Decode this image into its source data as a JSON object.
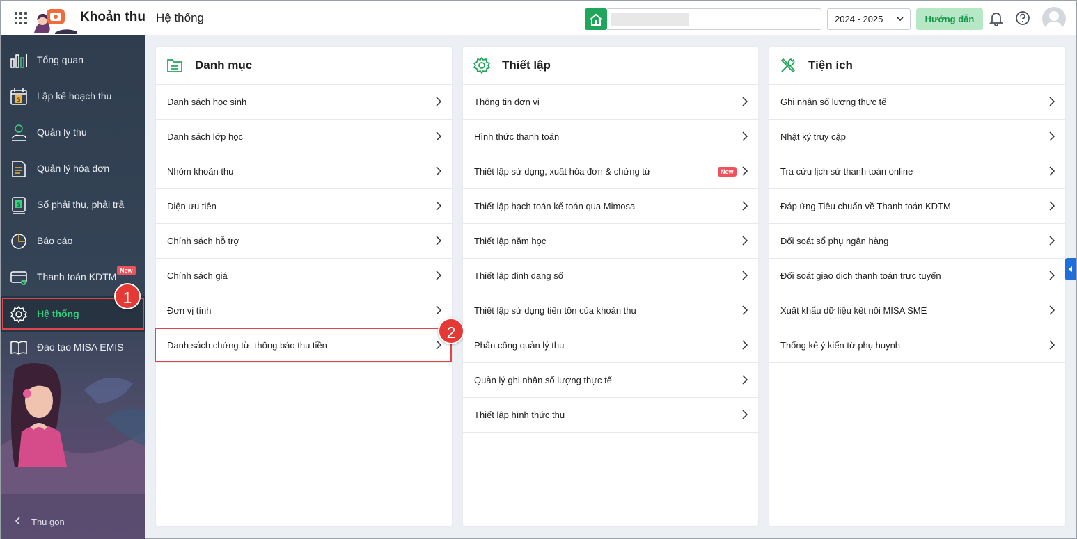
{
  "header": {
    "app_title": "Khoản thu",
    "module_title": "Hệ thống",
    "school_year": "2024 - 2025",
    "guide_label": "Hướng dẫn"
  },
  "sidebar": {
    "items": [
      {
        "label": "Tổng quan",
        "icon": "bar-chart-icon"
      },
      {
        "label": "Lập kế hoạch thu",
        "icon": "calendar-money-icon"
      },
      {
        "label": "Quản lý thu",
        "icon": "coin-hand-icon"
      },
      {
        "label": "Quản lý hóa đơn",
        "icon": "invoice-icon"
      },
      {
        "label": "Sổ phải thu, phải trả",
        "icon": "ledger-icon"
      },
      {
        "label": "Báo cáo",
        "icon": "pie-chart-icon"
      },
      {
        "label": "Thanh toán KDTM",
        "icon": "card-check-icon",
        "badge": "New"
      },
      {
        "label": "Hệ thống",
        "icon": "gear-icon",
        "active": true
      },
      {
        "label": "Đào tạo MISA EMIS",
        "icon": "book-icon"
      }
    ],
    "collapse_label": "Thu gọn"
  },
  "annotations": {
    "step1": "1",
    "step2": "2"
  },
  "panels": {
    "danh_muc": {
      "title": "Danh mục",
      "rows": [
        "Danh sách học sinh",
        "Danh sách lớp học",
        "Nhóm khoản thu",
        "Diện ưu tiên",
        "Chính sách hỗ trợ",
        "Chính sách giá",
        "Đơn vị tính",
        "Danh sách chứng từ, thông báo thu tiền"
      ]
    },
    "thiet_lap": {
      "title": "Thiết lập",
      "rows": [
        "Thông tin đơn vị",
        "Hình thức thanh toán",
        "Thiết lập sử dụng, xuất hóa đơn & chứng từ",
        "Thiết lập hạch toán kế toán qua Mimosa",
        "Thiết lập năm học",
        "Thiết lập định dạng số",
        "Thiết lập sử dụng tiền tồn của khoản thu",
        "Phân công quản lý thu",
        "Quản lý ghi nhận số lượng thực tế",
        "Thiết lập hình thức thu"
      ],
      "new_badge": "New"
    },
    "tien_ich": {
      "title": "Tiện ích",
      "rows": [
        "Ghi nhận số lượng thực tế",
        "Nhật ký truy cập",
        "Tra cứu lịch sử thanh toán online",
        "Đáp ứng Tiêu chuẩn về Thanh toán KDTM",
        "Đối soát sổ phụ ngân hàng",
        "Đối soát giao dịch thanh toán trực tuyến",
        "Xuất khẩu dữ liệu kết nối MISA SME",
        "Thống kê ý kiến từ phụ huynh"
      ]
    }
  },
  "colors": {
    "accent_green": "#20a65a",
    "sidebar_bg": "#2f3d4f",
    "highlight_red": "#e0454b",
    "badge_red": "#f0525b"
  }
}
